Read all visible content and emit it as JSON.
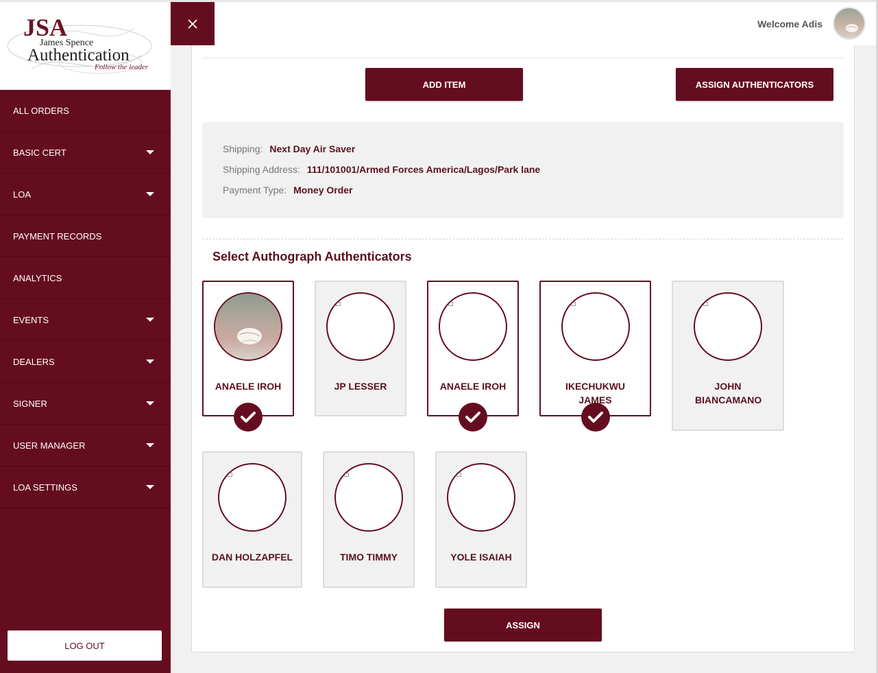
{
  "brand": {
    "logo_mark": "JSA",
    "logo_line1": "James Spence",
    "logo_line2": "Authentication",
    "tagline": "Follow the leader",
    "accent_color": "#650d20"
  },
  "sidebar": {
    "items": [
      {
        "label": "ALL ORDERS",
        "has_dropdown": false
      },
      {
        "label": "BASIC CERT",
        "has_dropdown": true
      },
      {
        "label": "LOA",
        "has_dropdown": true
      },
      {
        "label": "PAYMENT RECORDS",
        "has_dropdown": false
      },
      {
        "label": "ANALYTICS",
        "has_dropdown": false
      },
      {
        "label": "EVENTS",
        "has_dropdown": true
      },
      {
        "label": "DEALERS",
        "has_dropdown": true
      },
      {
        "label": "SIGNER",
        "has_dropdown": true
      },
      {
        "label": "USER MANAGER",
        "has_dropdown": true
      },
      {
        "label": "LOA SETTINGS",
        "has_dropdown": true
      }
    ],
    "logout_label": "LOG OUT"
  },
  "header": {
    "close_icon": "close-icon",
    "welcome_text": "Welcome Adis"
  },
  "actions": {
    "add_item_label": "ADD ITEM",
    "assign_authenticators_label": "ASSIGN AUTHENTICATORS"
  },
  "order_info": {
    "shipping_label": "Shipping:",
    "shipping_value": "Next Day Air Saver",
    "address_label": "Shipping Address:",
    "address_value": "111/101001/Armed Forces America/Lagos/Park lane",
    "payment_label": "Payment Type:",
    "payment_value": "Money Order"
  },
  "authenticators": {
    "title": "Select Authograph Authenticators",
    "cards": [
      {
        "name": "ANAELE IROH",
        "selected": true,
        "has_photo": true
      },
      {
        "name": "JP LESSER",
        "selected": false,
        "has_photo": false
      },
      {
        "name": "ANAELE IROH",
        "selected": true,
        "has_photo": false
      },
      {
        "name": "IKECHUKWU JAMES",
        "selected": true,
        "has_photo": false
      },
      {
        "name": "JOHN BIANCAMANO",
        "selected": false,
        "has_photo": false
      },
      {
        "name": "DAN HOLZAPFEL",
        "selected": false,
        "has_photo": false
      },
      {
        "name": "TIMO TIMMY",
        "selected": false,
        "has_photo": false
      },
      {
        "name": "YOLE ISAIAH",
        "selected": false,
        "has_photo": false
      }
    ]
  },
  "assign_label": "ASSIGN"
}
